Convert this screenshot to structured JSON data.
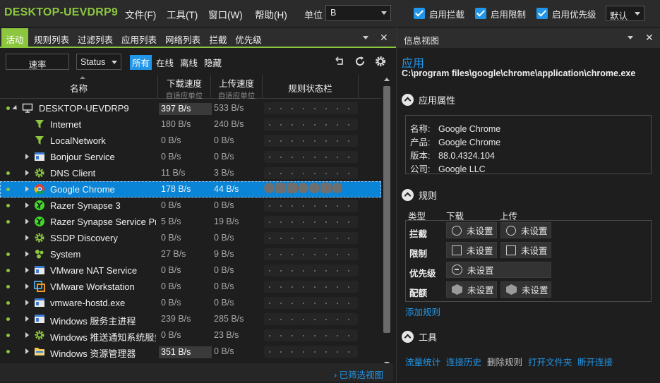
{
  "app": {
    "title": "DESKTOP-UEVDRP9"
  },
  "menu": [
    "文件(F)",
    "工具(T)",
    "窗口(W)",
    "帮助(H)"
  ],
  "unit": {
    "label": "单位",
    "value": "B"
  },
  "checks": [
    {
      "label": "启用拦截",
      "checked": true
    },
    {
      "label": "启用限制",
      "checked": true
    },
    {
      "label": "启用优先级",
      "checked": true
    }
  ],
  "priority_select": "默认",
  "tabs": [
    "活动",
    "规则列表",
    "过滤列表",
    "应用列表",
    "网络列表",
    "拦截",
    "优先级"
  ],
  "filter": {
    "rate": "速率",
    "status": "Status",
    "options": [
      "所有",
      "在线",
      "离线",
      "隐藏"
    ]
  },
  "table": {
    "headers": {
      "name": "名称",
      "download": "下载速度",
      "download_sub": "自适应单位",
      "upload": "上传速度",
      "upload_sub": "自适应单位",
      "rules": "规则状态栏"
    },
    "rows": [
      {
        "name": "DESKTOP-UEVDRP9",
        "dl": "397 B/s",
        "ul": "533 B/s"
      },
      {
        "name": "Internet",
        "dl": "180 B/s",
        "ul": "240 B/s"
      },
      {
        "name": "LocalNetwork",
        "dl": "0 B/s",
        "ul": "0 B/s"
      },
      {
        "name": "Bonjour Service",
        "dl": "0 B/s",
        "ul": "0 B/s"
      },
      {
        "name": "DNS Client",
        "dl": "11 B/s",
        "ul": "3 B/s"
      },
      {
        "name": "Google Chrome",
        "dl": "178 B/s",
        "ul": "44 B/s"
      },
      {
        "name": "Razer Synapse 3",
        "dl": "0 B/s",
        "ul": "0 B/s"
      },
      {
        "name": "Razer Synapse Service Process",
        "dl": "5 B/s",
        "ul": "19 B/s"
      },
      {
        "name": "SSDP Discovery",
        "dl": "0 B/s",
        "ul": "0 B/s"
      },
      {
        "name": "System",
        "dl": "27 B/s",
        "ul": "9 B/s"
      },
      {
        "name": "VMware NAT Service",
        "dl": "0 B/s",
        "ul": "0 B/s"
      },
      {
        "name": "VMware Workstation",
        "dl": "0 B/s",
        "ul": "0 B/s"
      },
      {
        "name": "vmware-hostd.exe",
        "dl": "0 B/s",
        "ul": "0 B/s"
      },
      {
        "name": "Windows 服务主进程",
        "dl": "239 B/s",
        "ul": "285 B/s"
      },
      {
        "name": "Windows 推送通知系统服务",
        "dl": "0 B/s",
        "ul": "23 B/s"
      },
      {
        "name": "Windows 资源管理器",
        "dl": "351 B/s",
        "ul": "0 B/s"
      }
    ]
  },
  "footer_link": "已筛选视图",
  "info": {
    "title": "信息视图",
    "heading": "应用",
    "path": "C:\\program files\\google\\chrome\\application\\chrome.exe",
    "props_title": "应用属性",
    "props": [
      {
        "k": "名称:",
        "v": "Google Chrome"
      },
      {
        "k": "产品:",
        "v": "Google Chrome"
      },
      {
        "k": "版本:",
        "v": "88.0.4324.104"
      },
      {
        "k": "公司:",
        "v": "Google LLC"
      }
    ],
    "rules_title": "规则",
    "col_type": "类型",
    "col_download": "下载",
    "col_upload": "上传",
    "rules": [
      {
        "label": "拦截",
        "dl": "未设置",
        "ul": "未设置"
      },
      {
        "label": "限制",
        "dl": "未设置",
        "ul": "未设置"
      },
      {
        "label": "优先级",
        "dl": "未设置"
      },
      {
        "label": "配额",
        "dl": "未设置",
        "ul": "未设置"
      }
    ],
    "add_rule": "添加规则",
    "tools_title": "工具",
    "tools": [
      "流量统计",
      "连接历史",
      "删除规则",
      "打开文件夹",
      "断开连接"
    ]
  },
  "colors": {
    "accent_green": "#8cc63f",
    "accent_blue": "#2196e8",
    "selected_row": "#0a84d6"
  },
  "icons": {
    "settings": "gear-icon",
    "refresh": "refresh-icon",
    "undo": "undo-icon"
  }
}
